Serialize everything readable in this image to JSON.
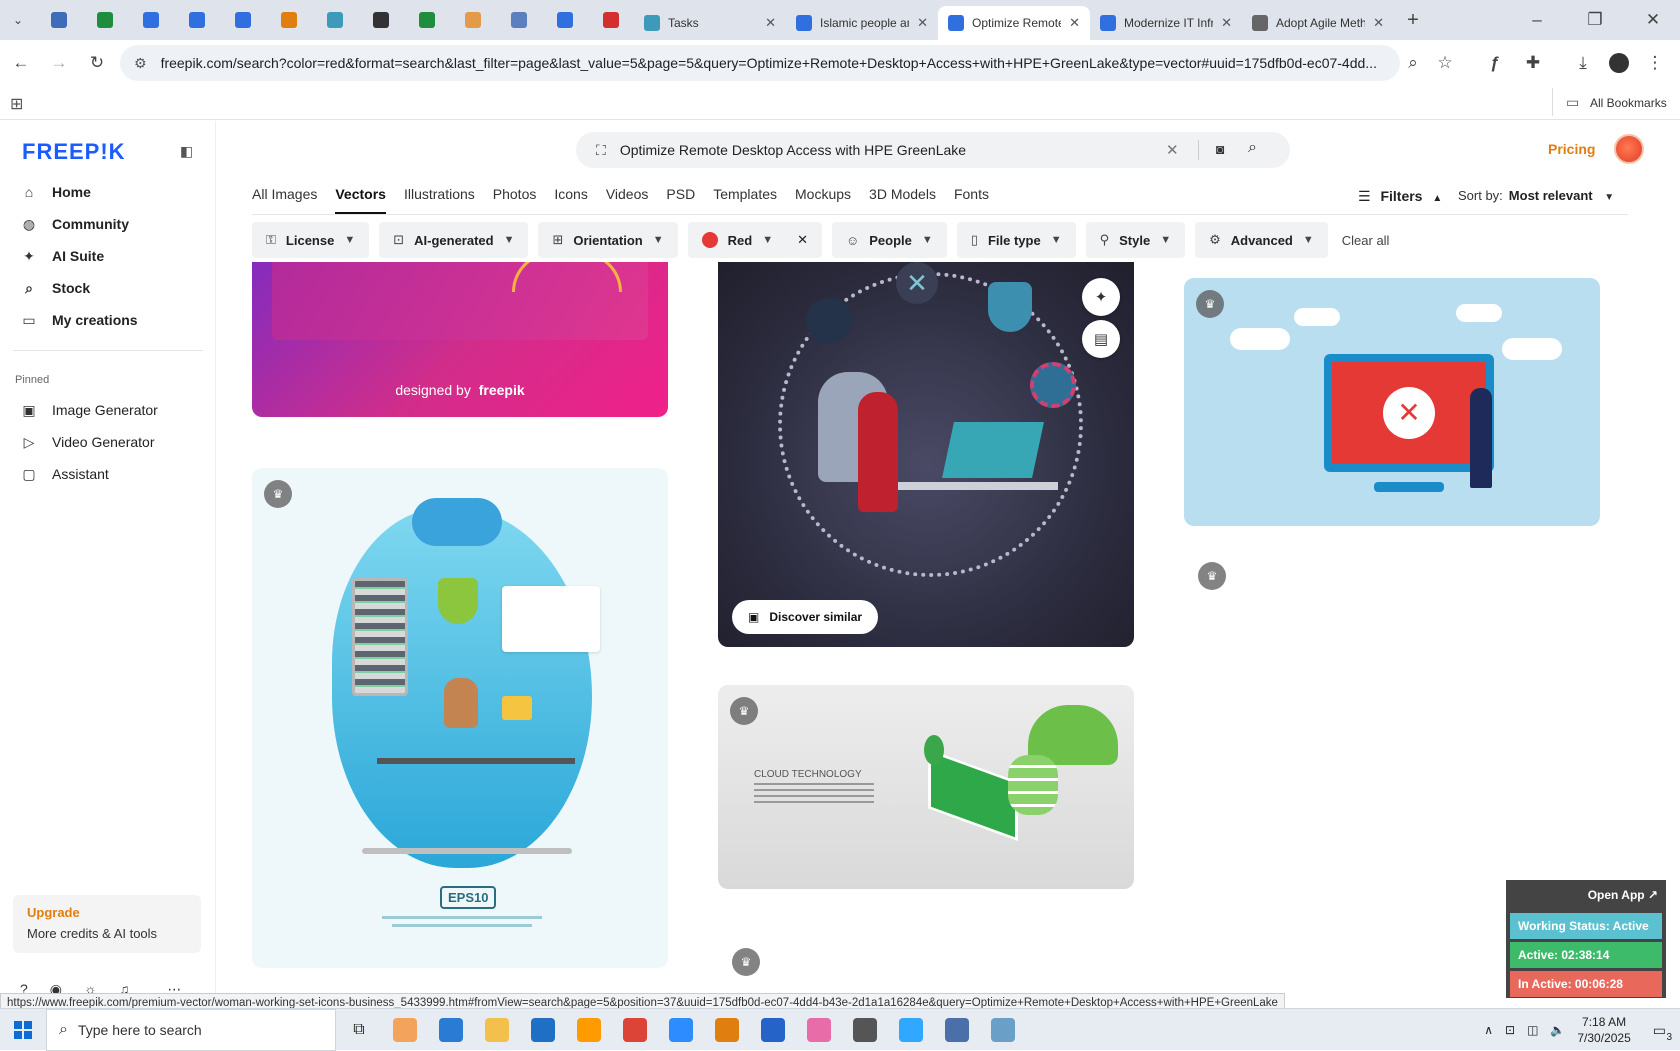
{
  "browser": {
    "tabs": [
      {
        "label": "Tasks",
        "fav": "#3d9ab8"
      },
      {
        "label": "Islamic people an",
        "fav": "#2f6fe0"
      },
      {
        "label": "Optimize Remote",
        "fav": "#2f6fe0",
        "active": true
      },
      {
        "label": "Modernize IT Infr",
        "fav": "#2f6fe0"
      },
      {
        "label": "Adopt Agile Meth",
        "fav": "#666"
      }
    ],
    "pinned_favicon_colors": [
      "#3d6cb8",
      "#1e8e3e",
      "#2f6fe0",
      "#2f6fe0",
      "#2f6fe0",
      "#e07e10",
      "#3d9ab8",
      "#333",
      "#1e8e3e",
      "#e39b4a",
      "#5b7fbf",
      "#2f6fe0",
      "#d32f2f"
    ],
    "url": "freepik.com/search?color=red&format=search&last_filter=page&last_value=5&page=5&query=Optimize+Remote+Desktop+Access+with+HPE+GreenLake&type=vector#uuid=175dfb0d-ec07-4dd...",
    "all_bookmarks": "All Bookmarks"
  },
  "sidebar": {
    "logo": "FREEP!K",
    "main": [
      {
        "label": "Home",
        "icon": "home-icon",
        "glyph": "⌂"
      },
      {
        "label": "Community",
        "icon": "globe-icon",
        "glyph": "◍"
      },
      {
        "label": "AI Suite",
        "icon": "sparkle-icon",
        "glyph": "✦"
      },
      {
        "label": "Stock",
        "icon": "search-icon",
        "glyph": "⌕"
      },
      {
        "label": "My creations",
        "icon": "folder-icon",
        "glyph": "▭"
      }
    ],
    "pinned_label": "Pinned",
    "pinned": [
      {
        "label": "Image Generator",
        "icon": "image-icon",
        "glyph": "▣"
      },
      {
        "label": "Video Generator",
        "icon": "video-icon",
        "glyph": "▷"
      },
      {
        "label": "Assistant",
        "icon": "chat-icon",
        "glyph": "▢"
      }
    ],
    "upgrade": {
      "title": "Upgrade",
      "subtitle": "More credits & AI tools"
    }
  },
  "header": {
    "search_query": "Optimize Remote Desktop Access with HPE GreenLake",
    "pricing": "Pricing"
  },
  "category_tabs": [
    "All Images",
    "Vectors",
    "Illustrations",
    "Photos",
    "Icons",
    "Videos",
    "PSD",
    "Templates",
    "Mockups",
    "3D Models",
    "Fonts"
  ],
  "active_category": "Vectors",
  "filters_label": "Filters",
  "sort": {
    "label": "Sort by:",
    "value": "Most relevant"
  },
  "filter_chips": [
    {
      "label": "License",
      "icon": "license-icon",
      "glyph": "⚿"
    },
    {
      "label": "AI-generated",
      "icon": "ai-icon",
      "glyph": "⊡"
    },
    {
      "label": "Orientation",
      "icon": "orientation-icon",
      "glyph": "⊞"
    },
    {
      "label": "Red",
      "icon": "color-dot-icon",
      "glyph": ""
    },
    {
      "label": "People",
      "icon": "people-icon",
      "glyph": "☺"
    },
    {
      "label": "File type",
      "icon": "file-icon",
      "glyph": "▯"
    },
    {
      "label": "Style",
      "icon": "style-icon",
      "glyph": "⚲"
    },
    {
      "label": "Advanced",
      "icon": "gear-icon",
      "glyph": "⚙"
    }
  ],
  "clear_all": "Clear all",
  "cards": {
    "designed_by": "designed by",
    "designed_brand": "freepik",
    "discover_similar": "Discover similar",
    "cloud_title": "CLOUD TECHNOLOGY",
    "eps_label": "EPS10"
  },
  "status_url": "https://www.freepik.com/premium-vector/woman-working-set-icons-business_5433999.htm#fromView=search&page=5&position=37&uuid=175dfb0d-ec07-4dd4-b43e-2d1a1a16284e&query=Optimize+Remote+Desktop+Access+with+HPE+GreenLake",
  "work_widget": {
    "open_app": "Open App ↗",
    "status": "Working Status: Active",
    "active": "Active: 02:38:14",
    "inactive": "In Active: 00:06:28",
    "colors": {
      "status": "#5bc0cf",
      "active": "#3dbb6a",
      "inactive": "#e8685c"
    }
  },
  "taskbar": {
    "search_placeholder": "Type here to search",
    "apps": [
      "#f3a35b",
      "#2a7bd4",
      "#f2c04b",
      "#1f6fc5",
      "#ff9a00",
      "#db4437",
      "#2d8cff",
      "#e07e10",
      "#2563c9",
      "#e86ca8",
      "#555",
      "#31a8ff",
      "#4b6fa8",
      "#6aa0c8"
    ],
    "time": "7:18 AM",
    "date": "7/30/2025",
    "notif_count": "3"
  }
}
